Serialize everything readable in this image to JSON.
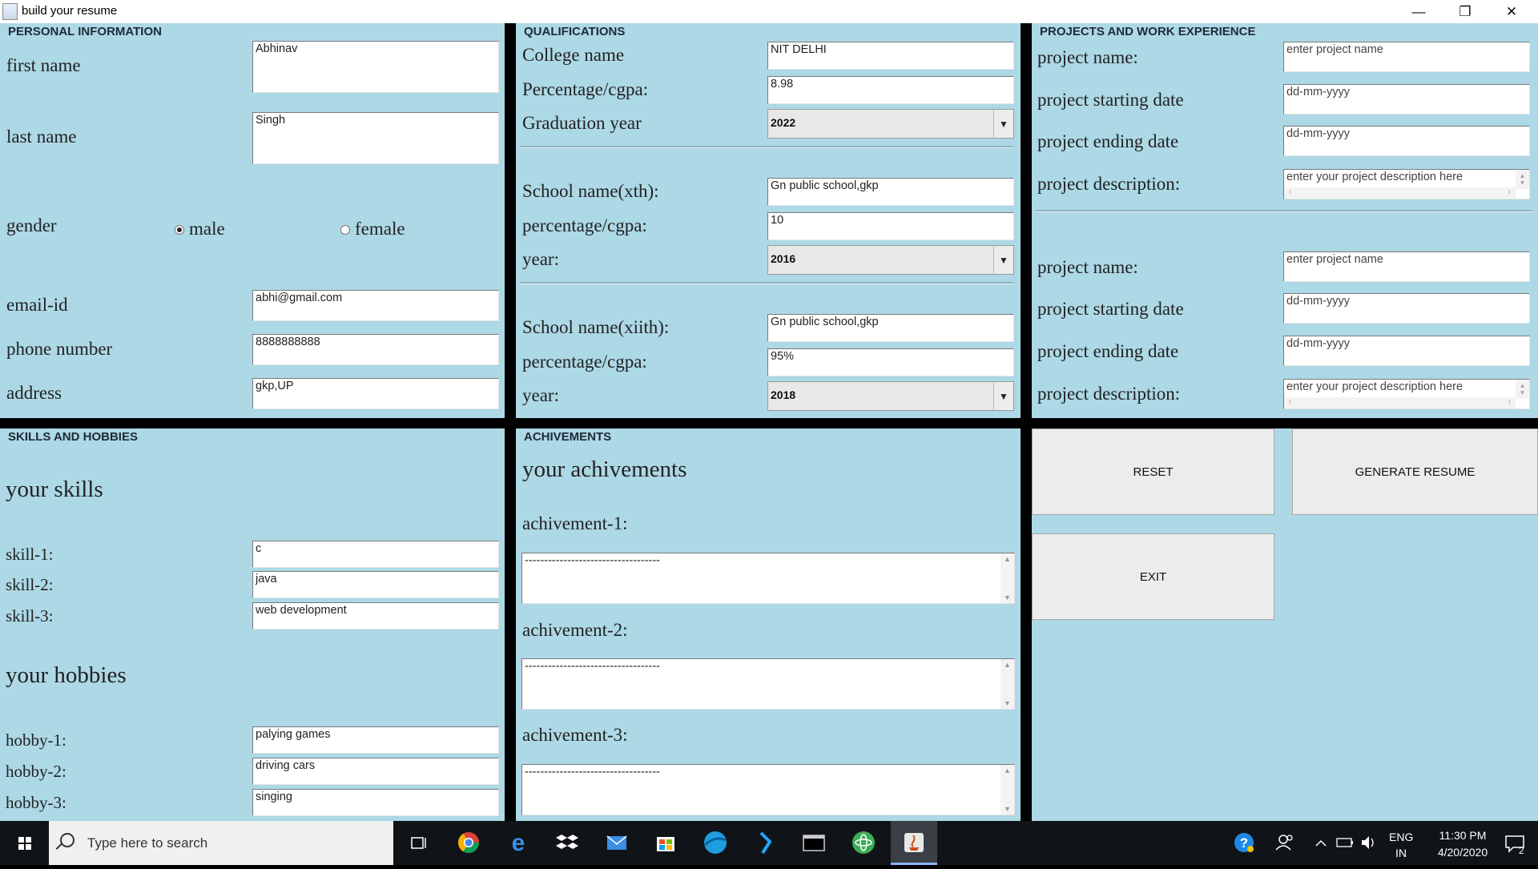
{
  "window": {
    "title": "build your resume",
    "controls": {
      "minimize": "—",
      "maximize": "❐",
      "close": "✕"
    }
  },
  "personal": {
    "header": "PERSONAL INFORMATION",
    "first_name_label": "first name",
    "first_name": "Abhinav",
    "last_name_label": "last name",
    "last_name": "Singh",
    "gender_label": "gender",
    "male": "male",
    "female": "female",
    "selected_gender": "male",
    "email_label": "email-id",
    "email": "abhi@gmail.com",
    "phone_label": "phone number",
    "phone": "8888888888",
    "address_label": "address",
    "address": "gkp,UP"
  },
  "qualifications": {
    "header": "QUALIFICATIONS",
    "college_label": "College name",
    "college": "NIT DELHI",
    "percent1_label": "Percentage/cgpa:",
    "percent1": "8.98",
    "grad_year_label": "Graduation year",
    "grad_year": "2022",
    "school10_label": "School name(xth):",
    "school10": "Gn public school,gkp",
    "percent2_label": "percentage/cgpa:",
    "percent2": "10",
    "year2_label": "year:",
    "year2": "2016",
    "school12_label": "School name(xiith):",
    "school12": "Gn public school,gkp",
    "percent3_label": "percentage/cgpa:",
    "percent3": "95%",
    "year3_label": "year:",
    "year3": "2018"
  },
  "projects": {
    "header": "PROJECTS AND WORK EXPERIENCE",
    "name_label": "project name:",
    "start_label": "project starting date",
    "end_label": "project ending date",
    "desc_label": "project description:",
    "name_value": "enter project name",
    "date_value": "dd-mm-yyyy",
    "desc_value": "enter your project description here"
  },
  "skills": {
    "header": "SKILLS AND HOBBIES",
    "skills_title": "your skills",
    "skill1_label": "skill-1:",
    "skill1": "c",
    "skill2_label": "skill-2:",
    "skill2": "java",
    "skill3_label": "skill-3:",
    "skill3": "web development",
    "hobbies_title": "your hobbies",
    "hobby1_label": "hobby-1:",
    "hobby1": "palying games",
    "hobby2_label": "hobby-2:",
    "hobby2": "driving cars",
    "hobby3_label": "hobby-3:",
    "hobby3": "singing"
  },
  "achievements": {
    "header": "ACHIVEMENTS",
    "title": "your achivements",
    "a1_label": "achivement-1:",
    "a1": "-----------------------------------",
    "a2_label": "achivement-2:",
    "a2": "-----------------------------------",
    "a3_label": "achivement-3:",
    "a3": "-----------------------------------"
  },
  "actions": {
    "reset": "RESET",
    "generate": "GENERATE RESUME",
    "exit": "EXIT"
  },
  "taskbar": {
    "search_placeholder": "Type here to search",
    "lang": "ENG",
    "region": "IN",
    "time": "11:30 PM",
    "date": "4/20/2020",
    "notifications": "2"
  },
  "colors": {
    "panel": "#add8e6",
    "divider": "#000000",
    "button": "#ececec"
  }
}
